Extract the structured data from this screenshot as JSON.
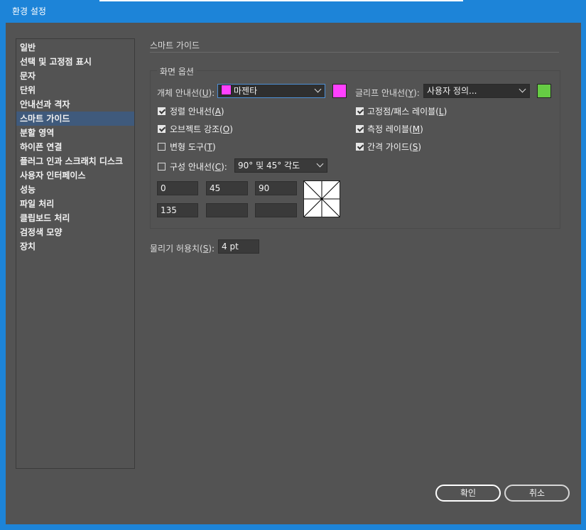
{
  "window": {
    "title": "환경 설정"
  },
  "sidebar": {
    "items": [
      {
        "label": "일반"
      },
      {
        "label": "선택 및 고정점 표시"
      },
      {
        "label": "문자"
      },
      {
        "label": "단위"
      },
      {
        "label": "안내선과 격자"
      },
      {
        "label": "스마트 가이드",
        "selected": true
      },
      {
        "label": "분할 영역"
      },
      {
        "label": "하이픈 연결"
      },
      {
        "label": "플러그 인과 스크래치 디스크"
      },
      {
        "label": "사용자 인터페이스"
      },
      {
        "label": "성능"
      },
      {
        "label": "파일 처리"
      },
      {
        "label": "클립보드 처리"
      },
      {
        "label": "검정색 모양"
      },
      {
        "label": "장치"
      }
    ]
  },
  "panel": {
    "section_title": "스마트 가이드",
    "group_title": "화면 옵션",
    "object_guides": {
      "label": "개체 안내선(",
      "mnemonic": "U",
      "label_end": "):",
      "value": "마젠타",
      "swatch_color": "#ff40ff"
    },
    "glyph_guides": {
      "label": "글리프 안내선(",
      "mnemonic": "Y",
      "label_end": "):",
      "value": "사용자 정의...",
      "swatch_color": "#66cc44"
    },
    "checks_left": [
      {
        "label": "정렬 안내선(",
        "mnemonic": "A",
        "end": ")",
        "checked": true
      },
      {
        "label": "오브젝트 강조(",
        "mnemonic": "O",
        "end": ")",
        "checked": true
      },
      {
        "label": "변형 도구(",
        "mnemonic": "T",
        "end": ")",
        "checked": false
      }
    ],
    "checks_right": [
      {
        "label": "고정점/패스 레이블(",
        "mnemonic": "L",
        "end": ")",
        "checked": true
      },
      {
        "label": "측정 레이블(",
        "mnemonic": "M",
        "end": ")",
        "checked": true
      },
      {
        "label": "간격 가이드(",
        "mnemonic": "S",
        "end": ")",
        "checked": true
      }
    ],
    "construction": {
      "label": "구성 안내선(",
      "mnemonic": "C",
      "end": "):",
      "checked": false,
      "value": "90° 및 45° 각도"
    },
    "angles": [
      "0",
      "45",
      "90",
      "135",
      "",
      ""
    ],
    "snapping": {
      "label": "물리기 허용치(",
      "mnemonic": "S",
      "end": "):",
      "value": "4 pt"
    }
  },
  "buttons": {
    "ok": "확인",
    "cancel": "취소"
  }
}
